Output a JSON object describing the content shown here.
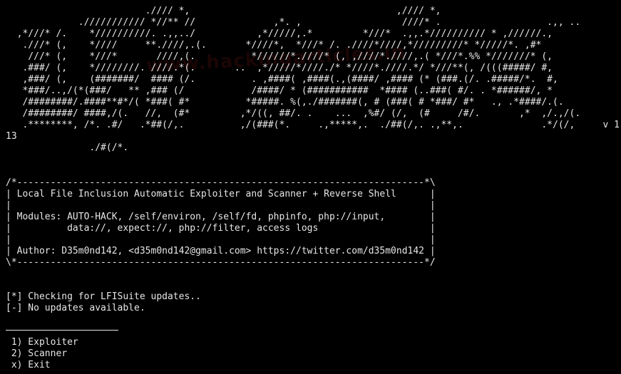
{
  "terminal": {
    "background": "#000000",
    "foreground": "#e6e6e6",
    "banner": [
      "                         .//// *,                                     ,//// *,",
      "             ./////////// *//** //              ,*. ,                  ////* .                   .,, ..",
      "  ,*///* /.    *//////////. .,,../           ,*/////,.*         *///*  .,,.*////////// * ,//////.,",
      "   .///* (,    *////     **.////,.(.       *////*,  *///* /. .////*////,*/////////* */////*. ,#*",
      "    ///* (,    *///*       ////,(.          *//////*.////* (, ,////*.////,.( *///*.%% *///////* (,",
      "   .###/ (,    *////////. ////.*(.       ..  ,*/////*////./* *////*.////.*/ *///**(, /(((#####/ #,",
      "   ,###/ (,    (#######/  #### (/.          . ,####( ,####(.,(####/ ,#### (* (###.(/. .#####/*.  #,",
      "   *###/..,/(*(###/   ** ,### (/            /####/ * (###########  *#### (..###( #/. . *######/, *",
      "   /########/.####**#*/( *###( #*          *#####. %(,./#######(, # (###( # *###/ #*   ., .*####/.(.",
      "   /########/ ####,/(.   //,  (#*         ,*/((, ##/. .    ...  ,%#/ (/,  (#     /#/.       ,*  ,/.,/(.",
      "   .********, /*. .#/   .*##(/,.          ,/(###(*.     .,*****,.  ./##(/,. .,**,.              .*/(/,     v 1.",
      "13",
      "               ./#(/*."
    ],
    "info_box": [
      "/*-------------------------------------------------------------------------*\\",
      "| Local File Inclusion Automatic Exploiter and Scanner + Reverse Shell      |",
      "|                                                                           |",
      "| Modules: AUTO-HACK, /self/environ, /self/fd, phpinfo, php://input,        |",
      "|          data://, expect://, php://filter, access logs                    |",
      "|                                                                           |",
      "| Author: D35m0nd142, <d35m0nd142@gmail.com> https://twitter.com/d35m0nd142 |",
      "\\*-------------------------------------------------------------------------*/"
    ],
    "status": [
      "[*] Checking for LFISuite updates..",
      "[-] No updates available."
    ],
    "menu": [
      " 1) Exploiter",
      " 2) Scanner",
      " x) Exit"
    ]
  }
}
